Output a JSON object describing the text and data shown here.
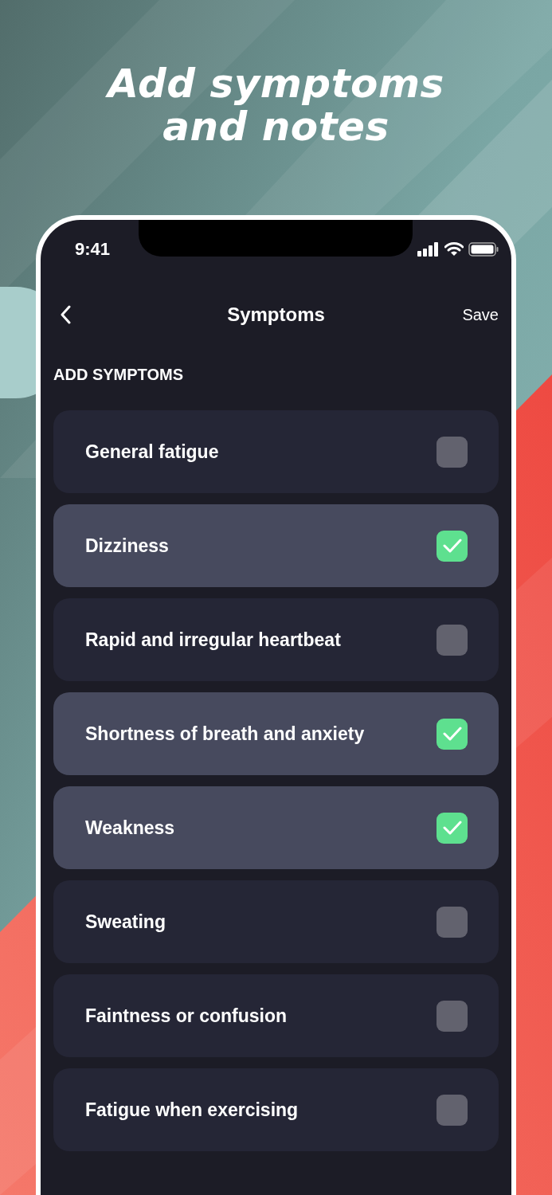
{
  "headline": [
    "Add symptoms",
    "and notes"
  ],
  "status_bar": {
    "time": "9:41"
  },
  "nav": {
    "title": "Symptoms",
    "action": "Save"
  },
  "section": "ADD SYMPTOMS",
  "symptoms": [
    {
      "label": "General fatigue",
      "checked": false
    },
    {
      "label": "Dizziness",
      "checked": true
    },
    {
      "label": "Rapid and irregular heartbeat",
      "checked": false
    },
    {
      "label": "Shortness of breath and anxiety",
      "checked": true
    },
    {
      "label": "Weakness",
      "checked": true
    },
    {
      "label": "Sweating",
      "checked": false
    },
    {
      "label": "Faintness or confusion",
      "checked": false
    },
    {
      "label": "Fatigue when exercising",
      "checked": false
    }
  ]
}
